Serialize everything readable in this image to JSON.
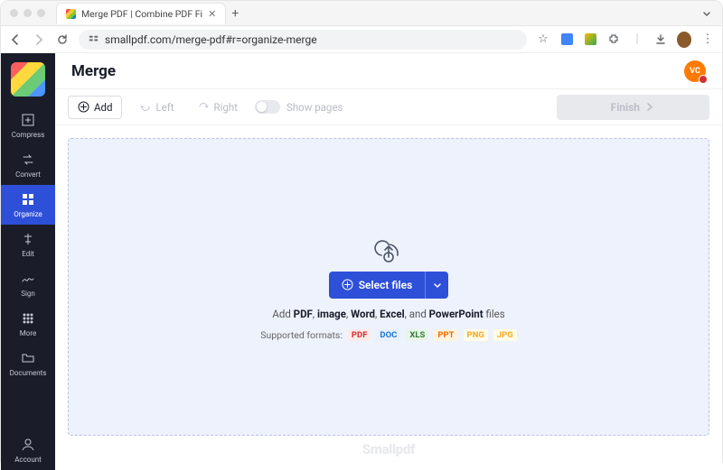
{
  "browser": {
    "tab_title": "Merge PDF | Combine PDF Fi",
    "url": "smallpdf.com/merge-pdf#r=organize-merge"
  },
  "header": {
    "title": "Merge",
    "user_initials": "VC"
  },
  "sidebar": {
    "items": [
      {
        "label": "Compress",
        "icon": "compress"
      },
      {
        "label": "Convert",
        "icon": "convert"
      },
      {
        "label": "Organize",
        "icon": "organize",
        "active": true
      },
      {
        "label": "Edit",
        "icon": "edit"
      },
      {
        "label": "Sign",
        "icon": "sign"
      },
      {
        "label": "More",
        "icon": "more"
      },
      {
        "label": "Documents",
        "icon": "documents"
      }
    ],
    "account_label": "Account"
  },
  "toolbar": {
    "add_label": "Add",
    "left_label": "Left",
    "right_label": "Right",
    "show_pages_label": "Show pages",
    "finish_label": "Finish"
  },
  "dropzone": {
    "select_label": "Select files",
    "hint_prefix": "Add ",
    "hint_bold1": "PDF",
    "hint_sep1": ", ",
    "hint_bold2": "image",
    "hint_sep2": ", ",
    "hint_bold3": "Word",
    "hint_sep3": ", ",
    "hint_bold4": "Excel",
    "hint_sep4": ", and ",
    "hint_bold5": "PowerPoint",
    "hint_suffix": " files",
    "formats_label": "Supported formats:",
    "formats": [
      "PDF",
      "DOC",
      "XLS",
      "PPT",
      "PNG",
      "JPG"
    ]
  },
  "watermark": "Smallpdf"
}
